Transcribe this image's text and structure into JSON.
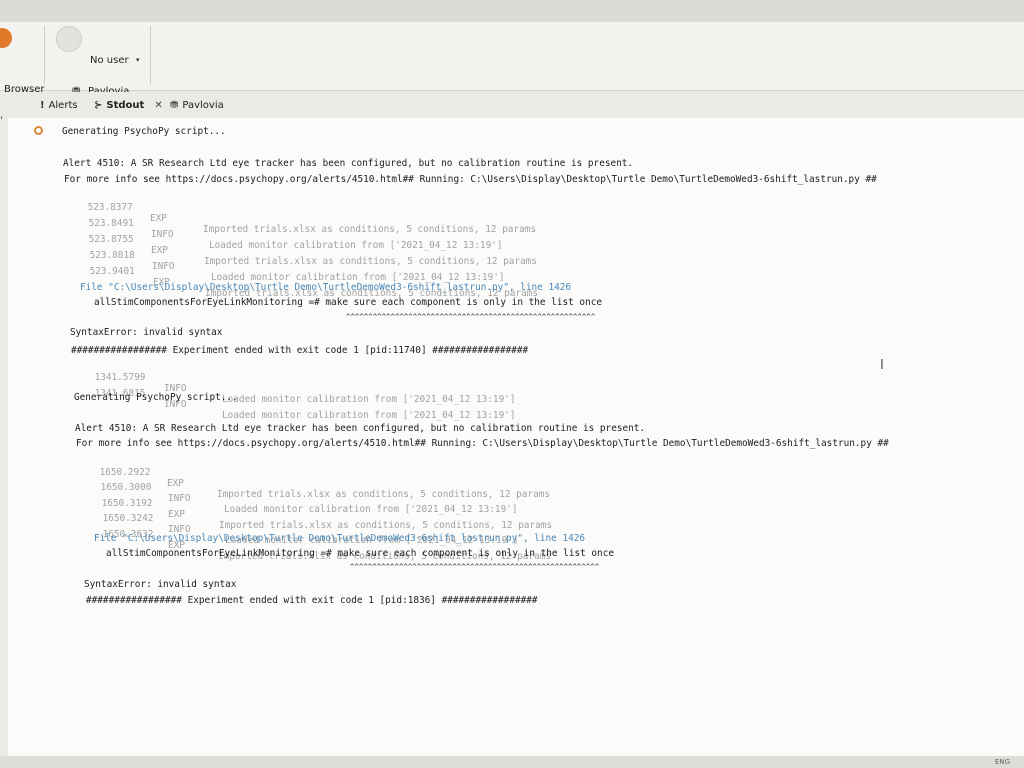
{
  "toolbar": {
    "browser_label": "Browser",
    "user_label": "No user",
    "user_caret": "▾",
    "pavlovia_label": "Pavlovia"
  },
  "tabs": [
    {
      "label": "Alerts",
      "icon": "!"
    },
    {
      "label": "Stdout",
      "icon": ">_",
      "close": "✕"
    },
    {
      "label": "Pavlovia",
      "icon": "pavlovia-icon"
    }
  ],
  "console": {
    "gen1": "Generating PsychoPy script...",
    "alert1": "Alert 4510: A SR Research Ltd eye tracker has been configured, but no calibration routine is present.",
    "info1": "For more info see https://docs.psychopy.org/alerts/4510.html## Running: C:\\Users\\Display\\Desktop\\Turtle Demo\\TurtleDemoWed3-6shift_lastrun.py ##",
    "log1": [
      {
        "t": "523.8377",
        "lvl": "EXP",
        "msg": "Imported trials.xlsx as conditions, 5 conditions, 12 params"
      },
      {
        "t": "523.8491",
        "lvl": "INFO",
        "msg": "Loaded monitor calibration from ['2021_04_12 13:19']"
      },
      {
        "t": "523.8755",
        "lvl": "EXP",
        "msg": "Imported trials.xlsx as conditions, 5 conditions, 12 params"
      },
      {
        "t": "523.8818",
        "lvl": "INFO",
        "msg": "Loaded monitor calibration from ['2021_04_12 13:19']"
      },
      {
        "t": "523.9401",
        "lvl": "EXP",
        "msg": "Imported trials.xlsx as conditions, 5 conditions, 12 params"
      }
    ],
    "file1": "File \"C:\\Users\\Display\\Desktop\\Turtle Demo\\TurtleDemoWed3-6shift_lastrun.py\", line 1426",
    "code1": "allStimComponentsForEyeLinkMonitoring =# make sure each component is only in the list once",
    "caret1": "^^^^^^^^^^^^^^^^^^^^^^^^^^^^^^^^^^^^^^^^^^^^^^^^^^^^^^^^",
    "err1": "SyntaxError: invalid syntax",
    "end1": "################# Experiment ended with exit code 1 [pid:11740] #################",
    "log2": [
      {
        "t": "1341.5799",
        "lvl": "INFO",
        "msg": "Loaded monitor calibration from ['2021_04_12 13:19']"
      },
      {
        "t": "1341.6815",
        "lvl": "INFO",
        "msg": "Loaded monitor calibration from ['2021_04_12 13:19']"
      }
    ],
    "gen2": "Generating PsychoPy script...",
    "alert2": "Alert 4510: A SR Research Ltd eye tracker has been configured, but no calibration routine is present.",
    "info2": "For more info see https://docs.psychopy.org/alerts/4510.html## Running: C:\\Users\\Display\\Desktop\\Turtle Demo\\TurtleDemoWed3-6shift_lastrun.py ##",
    "log3": [
      {
        "t": "1650.2922",
        "lvl": "EXP",
        "msg": "Imported trials.xlsx as conditions, 5 conditions, 12 params"
      },
      {
        "t": "1650.3000",
        "lvl": "INFO",
        "msg": "Loaded monitor calibration from ['2021_04_12 13:19']"
      },
      {
        "t": "1650.3192",
        "lvl": "EXP",
        "msg": "Imported trials.xlsx as conditions, 5 conditions, 12 params"
      },
      {
        "t": "1650.3242",
        "lvl": "INFO",
        "msg": "Loaded monitor calibration from ['2021_04_12 13:19']"
      },
      {
        "t": "1650.3632",
        "lvl": "EXP",
        "msg": "Imported trials.xlsx as conditions, 5 conditions, 12 params"
      }
    ],
    "file2": "File \"C:\\Users\\Display\\Desktop\\Turtle Demo\\TurtleDemoWed3-6shift_lastrun.py\", line 1426",
    "code2": "allStimComponentsForEyeLinkMonitoring =# make sure each component is only in the list once",
    "caret2": "^^^^^^^^^^^^^^^^^^^^^^^^^^^^^^^^^^^^^^^^^^^^^^^^^^^^^^^^",
    "err2": "SyntaxError: invalid syntax",
    "end2": "################# Experiment ended with exit code 1 [pid:1836] #################"
  },
  "taskbar": {
    "lang": "ENG"
  }
}
